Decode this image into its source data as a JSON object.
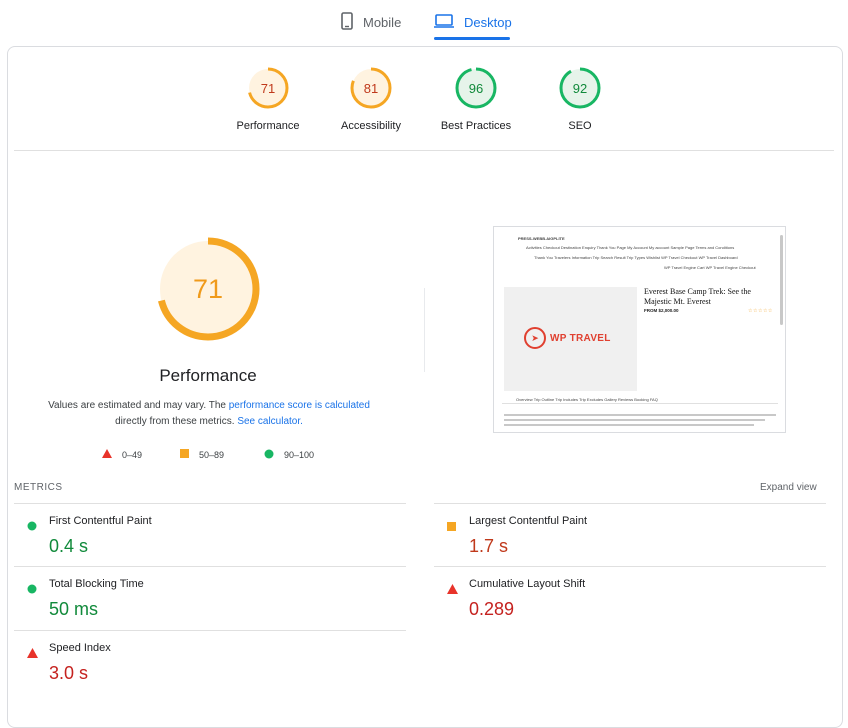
{
  "device_tabs": {
    "mobile_label": "Mobile",
    "desktop_label": "Desktop",
    "active": "Desktop"
  },
  "summary": [
    {
      "score": "71",
      "label": "Performance",
      "status": "average"
    },
    {
      "score": "81",
      "label": "Accessibility",
      "status": "average"
    },
    {
      "score": "96",
      "label": "Best Practices",
      "status": "pass"
    },
    {
      "score": "92",
      "label": "SEO",
      "status": "pass"
    }
  ],
  "performance": {
    "score": "71",
    "score_fraction": 0.71,
    "title": "Performance",
    "desc_prefix": "Values are estimated and may vary. The ",
    "desc_link1": "performance score is calculated",
    "desc_mid": " directly from these metrics. ",
    "desc_link2": "See calculator."
  },
  "legend": [
    {
      "range": "0–49",
      "shape": "triangle",
      "color": "#e8332a"
    },
    {
      "range": "50–89",
      "shape": "square",
      "color": "#f5a623"
    },
    {
      "range": "90–100",
      "shape": "circle",
      "color": "#18b663"
    }
  ],
  "thumbnail": {
    "site_name": "PRESS-WEBB.AIGPLITE",
    "nav_row1": "Activities   Checkout   Destination   Enquiry Thank You Page   My Account   My account   Sample Page   Terms and Conditions",
    "nav_row2": "Thank You   Travelers Information   Trip Search Result   Trip Types   Wishlist   WP Travel Checkout   WP Travel Dashboard",
    "nav_row3": "WP Travel Engine Cart   WP Travel Engine Checkout",
    "trip_title": "Everest Base Camp Trek: See the Majestic Mt. Everest",
    "price": "FROM $2,000.00",
    "logo_text": "WP TRAVEL",
    "tabs": "Overview     Trip Outline     Trip Includes     Trip Excludes     Gallery     Reviews     Booking     FAQ"
  },
  "metrics": {
    "heading": "METRICS",
    "expand_label": "Expand view",
    "items": [
      {
        "name": "First Contentful Paint",
        "value": "0.4 s",
        "status": "pass"
      },
      {
        "name": "Largest Contentful Paint",
        "value": "1.7 s",
        "status": "average"
      },
      {
        "name": "Total Blocking Time",
        "value": "50 ms",
        "status": "pass"
      },
      {
        "name": "Cumulative Layout Shift",
        "value": "0.289",
        "status": "fail"
      },
      {
        "name": "Speed Index",
        "value": "3.0 s",
        "status": "fail"
      }
    ]
  },
  "colors": {
    "pass": "#18b663",
    "average": "#f5a623",
    "fail": "#e8332a",
    "pass_text": "#118a3b",
    "average_text": "#c0391b",
    "fail_text": "#c5221f",
    "link": "#1a73e8"
  }
}
